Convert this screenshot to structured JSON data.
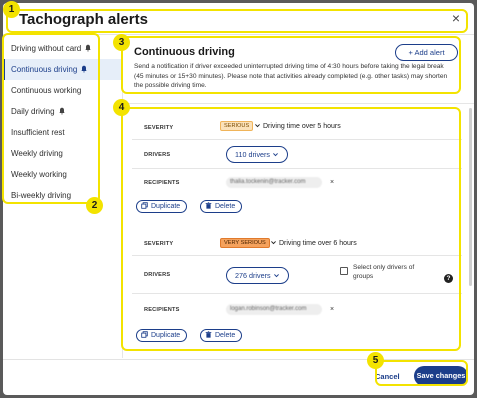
{
  "modal": {
    "title": "Tachograph alerts",
    "close_symbol": "×"
  },
  "sidebar": {
    "items": [
      {
        "label": "Driving without card",
        "bell": true,
        "active": false
      },
      {
        "label": "Continuous driving",
        "bell": true,
        "active": true
      },
      {
        "label": "Continuous working",
        "bell": false,
        "active": false
      },
      {
        "label": "Daily driving",
        "bell": true,
        "active": false
      },
      {
        "label": "Insufficient rest",
        "bell": false,
        "active": false
      },
      {
        "label": "Weekly driving",
        "bell": false,
        "active": false
      },
      {
        "label": "Weekly working",
        "bell": false,
        "active": false
      },
      {
        "label": "Bi-weekly driving",
        "bell": false,
        "active": false
      }
    ]
  },
  "section": {
    "title": "Continuous driving",
    "add_alert_label": "+ Add alert",
    "description": "Send a notification if driver exceeded uninterrupted driving time of 4:30 hours before taking the legal break (45 minutes or 15+30 minutes). Please note that activities already completed (e.g. other tasks) may shorten the possible driving time."
  },
  "alerts": [
    {
      "severity_label": "SEVERITY",
      "severity_badge": "SERIOUS",
      "severity_text": "Driving time over 5 hours",
      "drivers_label": "DRIVERS",
      "drivers_value": "110 drivers",
      "recipients_label": "RECIPIENTS",
      "recipient_chip": "thalia.tockenin@tracker.com",
      "duplicate_label": "Duplicate",
      "delete_label": "Delete"
    },
    {
      "severity_label": "SEVERITY",
      "severity_badge": "VERY SERIOUS",
      "severity_text": "Driving time over 6 hours",
      "drivers_label": "DRIVERS",
      "drivers_value": "276 drivers",
      "only_drivers_label": "Select only drivers of groups",
      "help_symbol": "?",
      "recipients_label": "RECIPIENTS",
      "recipient_chip": "logan.robinson@tracker.com",
      "duplicate_label": "Duplicate",
      "delete_label": "Delete"
    }
  ],
  "footer": {
    "cancel_label": "Cancel",
    "save_label": "Save changes"
  },
  "annotations": [
    "1",
    "2",
    "3",
    "4",
    "5"
  ],
  "colors": {
    "primary": "#1c3e8a",
    "highlight": "#f3e300",
    "serious": "#fbe1b9",
    "very_serious": "#f5a25d"
  }
}
